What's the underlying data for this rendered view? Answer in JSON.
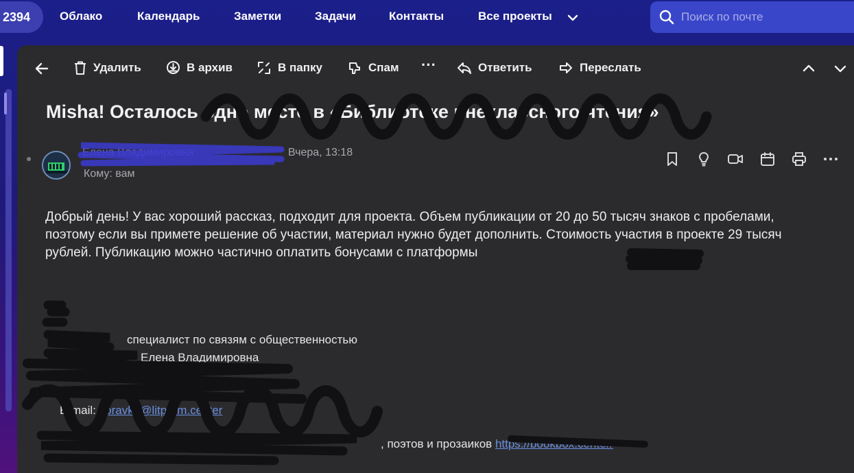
{
  "nav": {
    "counter": "2394",
    "links": [
      "Облако",
      "Календарь",
      "Заметки",
      "Задачи",
      "Контакты",
      "Все проекты"
    ],
    "search_placeholder": "Поиск по почте"
  },
  "toolbar": {
    "delete": "Удалить",
    "archive": "В архив",
    "to_folder": "В папку",
    "spam": "Спам",
    "more": "···",
    "reply": "Ответить",
    "forward": "Переслать"
  },
  "message": {
    "subject": "Misha! Осталось одно место в «Библиотеке внеклассного чтения»",
    "sender_name": "Елена Владимировна",
    "date": "Вчера, 13:18",
    "recipient": "Кому: вам",
    "body": "Добрый день! У вас хороший рассказ, подходит для проекта. Объем публикации от 20 до 50 тысяч знаков с пробелами, поэтому если вы примете решение об участии, материал нужно будет дополнить. Стоимость участия в проекте 29 тысяч рублей. Публикацию можно частично оплатить бонусами с платформы",
    "signature": {
      "role": "специалист по связям с общественностью",
      "name": "Елена Владимировна",
      "email_label": "E-mail:",
      "email_value": "spravka@litprom.center",
      "assoc_text": ", поэтов и прозаиков",
      "assoc_link": "https://bookbox.center/"
    }
  },
  "colors": {
    "panel_bg": "#2b2b2e",
    "nav_bg": "#1b1f8a",
    "search_bg": "#3a46c9",
    "link": "#6a8fe0"
  }
}
